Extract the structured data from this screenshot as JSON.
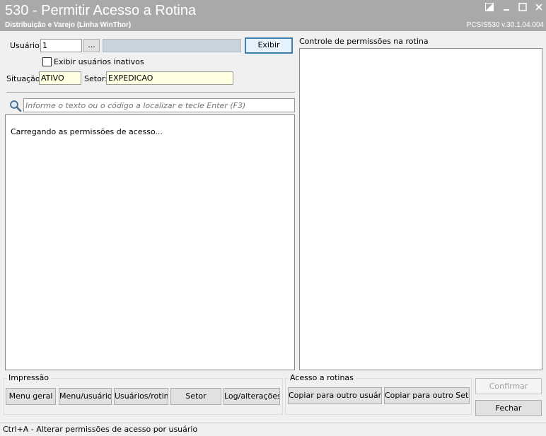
{
  "window": {
    "title": "530 - Permitir Acesso a Rotina",
    "subtitle": "Distribuição e Varejo (Linha WinThor)",
    "version": "PCSIS530  v.30.1.04.004"
  },
  "form": {
    "usuario_label": "Usuário:",
    "usuario_value": "1",
    "lookup_label": "...",
    "user_name_value": "",
    "exibir_label": "Exibir",
    "inativos_label": "Exibir usuários inativos",
    "situacao_label": "Situação:",
    "situacao_value": "ATIVO",
    "setor_label": "Setor:",
    "setor_value": "EXPEDICAO"
  },
  "search": {
    "placeholder": "Informe o texto ou o código a localizar e tecle Enter (F3)",
    "icon": "search-icon"
  },
  "tree": {
    "loading_text": "Carregando as permissões de acesso..."
  },
  "permissions": {
    "title": "Controle de permissões na rotina"
  },
  "impressao": {
    "title": "Impressão",
    "buttons": [
      "Menu geral",
      "Menu/usuário",
      "Usuários/rotina",
      "Setor",
      "Log/alterações"
    ]
  },
  "acesso": {
    "title": "Acesso a rotinas",
    "copy_user_label": "Copiar para outro usuário",
    "copy_setor_label": "Copiar para outro Setor"
  },
  "actions": {
    "confirmar_label": "Confirmar",
    "fechar_label": "Fechar"
  },
  "status": {
    "text": "Ctrl+A - Alterar permissões de acesso por usuário"
  },
  "colors": {
    "titlebar": "#a9a9a9",
    "field_highlight": "#ffffe1",
    "default_button_border": "#3c7fb1"
  }
}
